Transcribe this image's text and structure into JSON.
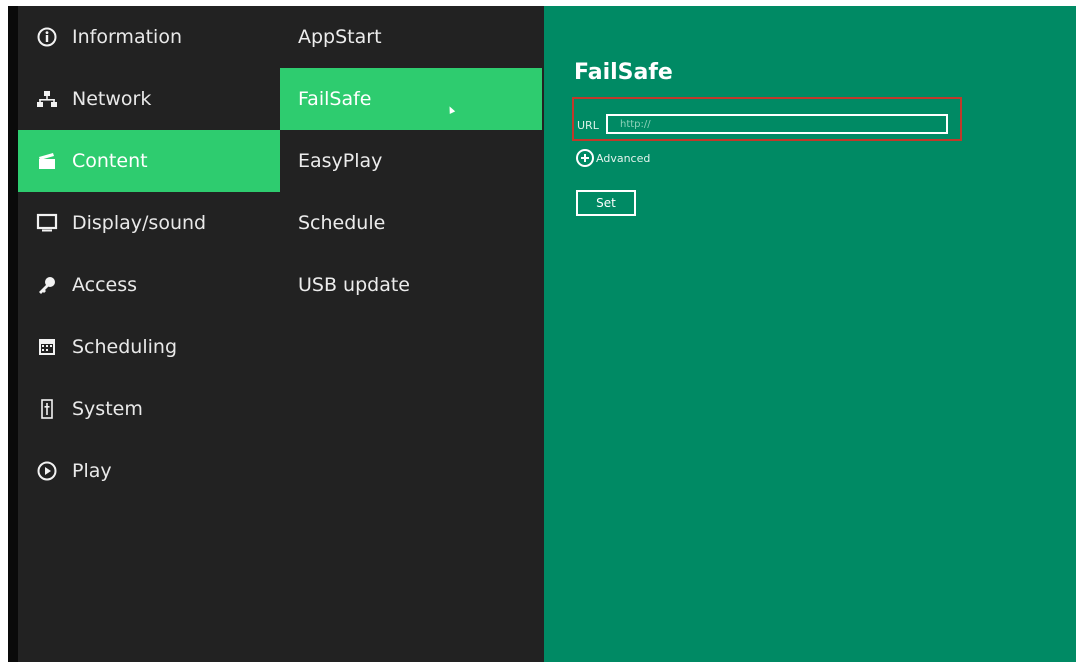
{
  "sidebar": {
    "items": [
      {
        "label": "Information",
        "icon": "info-icon"
      },
      {
        "label": "Network",
        "icon": "network-icon"
      },
      {
        "label": "Content",
        "icon": "clapperboard-icon",
        "active": true
      },
      {
        "label": "Display/sound",
        "icon": "monitor-icon"
      },
      {
        "label": "Access",
        "icon": "key-icon"
      },
      {
        "label": "Scheduling",
        "icon": "calendar-icon"
      },
      {
        "label": "System",
        "icon": "system-icon"
      },
      {
        "label": "Play",
        "icon": "play-icon"
      }
    ]
  },
  "submenu": {
    "items": [
      {
        "label": "AppStart"
      },
      {
        "label": "FailSafe",
        "active": true
      },
      {
        "label": "EasyPlay"
      },
      {
        "label": "Schedule"
      },
      {
        "label": "USB update"
      }
    ]
  },
  "panel": {
    "title": "FailSafe",
    "url_label": "URL",
    "url_placeholder": "http://",
    "url_value": "",
    "advanced_label": "Advanced",
    "set_label": "Set"
  },
  "colors": {
    "background": "#222222",
    "accent": "#2ecc6f",
    "panel": "#008a64",
    "highlight": "#c0392b"
  }
}
